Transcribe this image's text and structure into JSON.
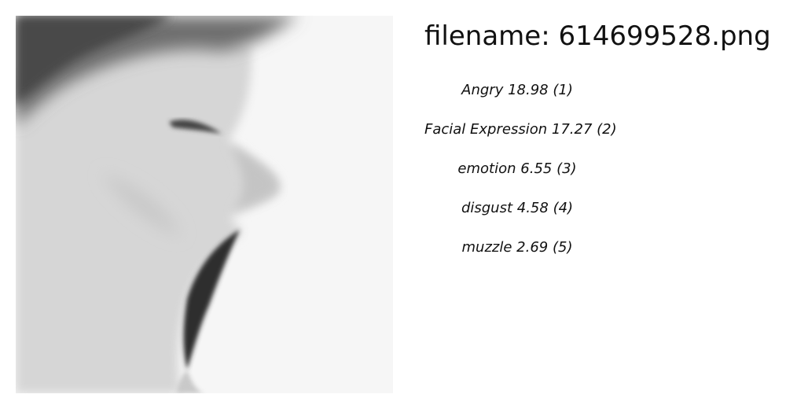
{
  "image": {
    "subject": "grayscale close-up side profile of a person with eyes closed and mouth wide open"
  },
  "filename_label": "filename:",
  "filename": "614699528.png",
  "predictions": [
    {
      "label": "Angry",
      "score": "18.98",
      "rank": "(1)"
    },
    {
      "label": "Facial Expression",
      "score": "17.27",
      "rank": "(2)"
    },
    {
      "label": "emotion",
      "score": "6.55",
      "rank": "(3)"
    },
    {
      "label": "disgust",
      "score": "4.58",
      "rank": "(4)"
    },
    {
      "label": "muzzle",
      "score": "2.69",
      "rank": "(5)"
    }
  ]
}
